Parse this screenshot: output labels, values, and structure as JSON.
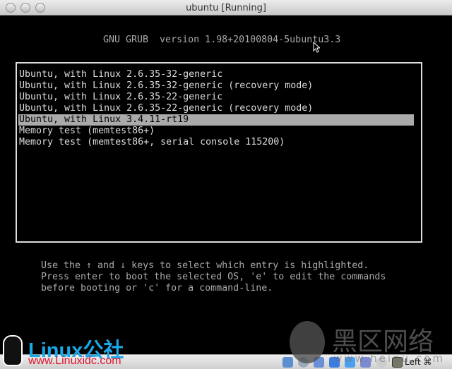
{
  "window": {
    "title": "ubuntu [Running]"
  },
  "grub": {
    "header": "GNU GRUB  version 1.98+20100804-5ubuntu3.3",
    "entries": [
      "Ubuntu, with Linux 2.6.35-32-generic",
      "Ubuntu, with Linux 2.6.35-32-generic (recovery mode)",
      "Ubuntu, with Linux 2.6.35-22-generic",
      "Ubuntu, with Linux 2.6.35-22-generic (recovery mode)",
      "Ubuntu, with Linux 3.4.11-rt19",
      "Memory test (memtest86+)",
      "Memory test (memtest86+, serial console 115200)"
    ],
    "selected_index": 4,
    "help": [
      "Use the ↑ and ↓ keys to select which entry is highlighted.",
      "Press enter to boot the selected OS, 'e' to edit the commands",
      "before booting or 'c' for a command-line."
    ]
  },
  "statusbar": {
    "icons": [
      "hard-disk-icon",
      "cd-icon",
      "usb-icon",
      "network-icon",
      "shared-folder-icon",
      "display-icon",
      "mouse-integration-icon",
      "keyboard-capture-icon"
    ],
    "host_key": "Left ⌘"
  },
  "watermarks": {
    "linux_logo": "Linux公社",
    "linux_url": "www.Linuxidc.com",
    "heiqu": "黑区网络",
    "heiqu_url": "www.heiqu.com"
  },
  "colors": {
    "grub_text": "#aaaaaa",
    "highlight": "#aaaaaa",
    "logo_blue": "#1aa7e6",
    "logo_red": "#e0102a"
  }
}
